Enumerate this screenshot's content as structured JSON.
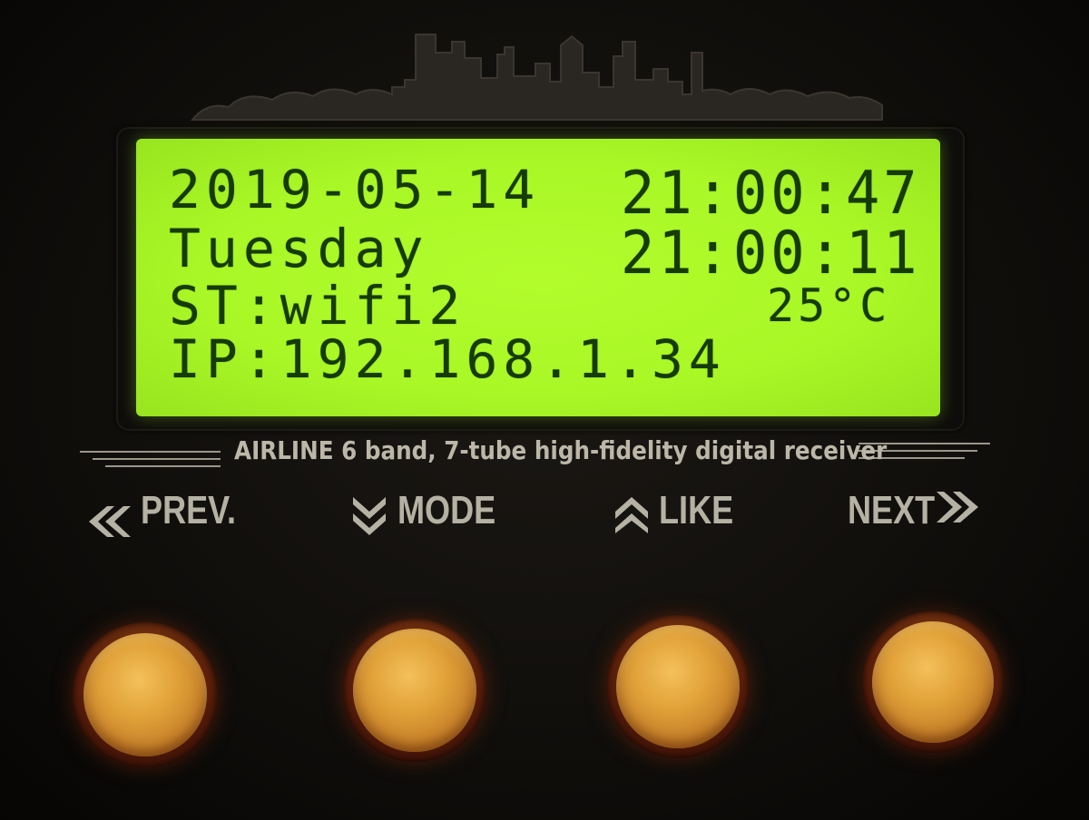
{
  "lcd": {
    "date": "2019-05-14",
    "day": "Tuesday",
    "status": "ST:wifi2",
    "ip": "IP:192.168.1.34",
    "time_line1": "21:00:47",
    "time_line2": "21:00:11",
    "temperature": "25°C"
  },
  "brand": {
    "text": "AIRLINE 6 band, 7-tube high-fidelity digital receiver"
  },
  "buttons": [
    {
      "label": "PREV.",
      "icon": "double-chevron-left-icon"
    },
    {
      "label": "MODE",
      "icon": "double-chevron-down-icon"
    },
    {
      "label": "LIKE",
      "icon": "double-chevron-up-icon"
    },
    {
      "label": "NEXT",
      "icon": "double-chevron-right-icon"
    }
  ],
  "colors": {
    "lcd_background": "#a9f726",
    "lcd_text": "#163b08",
    "panel": "#110f0c",
    "label": "#b5b1a3",
    "knob": "#e2a33a"
  }
}
